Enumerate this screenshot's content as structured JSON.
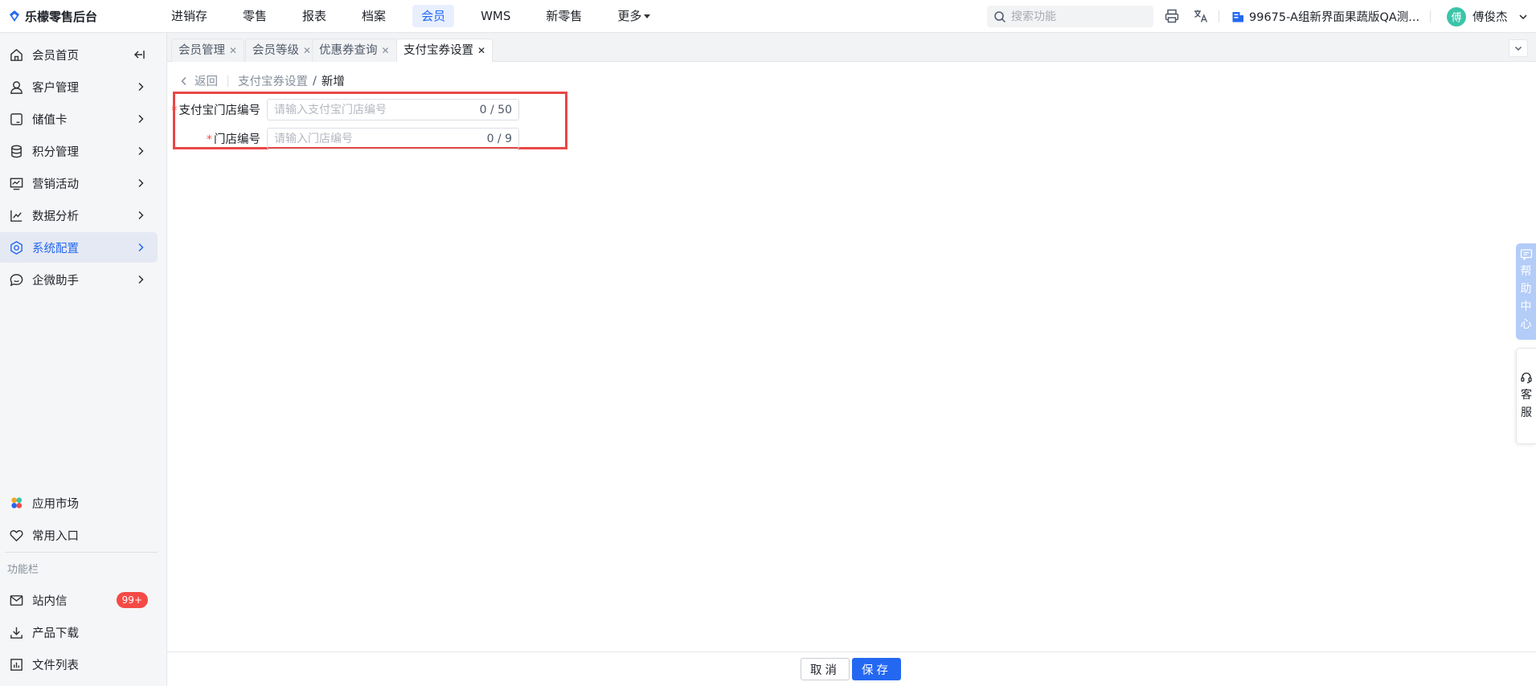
{
  "app": {
    "title": "乐檬零售后台"
  },
  "topnav": {
    "items": [
      "进销存",
      "零售",
      "报表",
      "档案",
      "会员",
      "WMS",
      "新零售",
      "更多"
    ],
    "active_index": 4,
    "search_placeholder": "搜索功能",
    "store_name": "99675-A组新界面果蔬版QA测...",
    "user_name": "傅俊杰",
    "avatar_char": "傅"
  },
  "sidebar": {
    "items": [
      {
        "label": "会员首页",
        "icon": "home-icon"
      },
      {
        "label": "客户管理",
        "icon": "user-icon"
      },
      {
        "label": "储值卡",
        "icon": "card-icon"
      },
      {
        "label": "积分管理",
        "icon": "database-icon"
      },
      {
        "label": "营销活动",
        "icon": "marketing-icon"
      },
      {
        "label": "数据分析",
        "icon": "chart-icon"
      },
      {
        "label": "系统配置",
        "icon": "settings-icon"
      },
      {
        "label": "企微助手",
        "icon": "chat-icon"
      }
    ],
    "active_index": 6,
    "bottom_items": [
      {
        "label": "应用市场",
        "icon": "app-market-icon"
      },
      {
        "label": "常用入口",
        "icon": "heart-icon"
      }
    ],
    "group_label": "功能栏",
    "function_items": [
      {
        "label": "站内信",
        "icon": "mail-icon",
        "badge": "99+"
      },
      {
        "label": "产品下载",
        "icon": "download-icon"
      },
      {
        "label": "文件列表",
        "icon": "file-list-icon"
      }
    ]
  },
  "tabs": [
    {
      "label": "会员管理",
      "active": false
    },
    {
      "label": "会员等级",
      "active": false
    },
    {
      "label": "优惠券查询",
      "active": false
    },
    {
      "label": "支付宝券设置",
      "active": true
    }
  ],
  "breadcrumb": {
    "back": "返回",
    "parent": "支付宝券设置",
    "separator": "/",
    "current": "新增"
  },
  "form": {
    "fields": [
      {
        "label": "支付宝门店编号",
        "placeholder": "请输入支付宝门店编号",
        "value": "",
        "count": "0 / 50",
        "required_mark": "*"
      },
      {
        "label": "门店编号",
        "placeholder": "请输入门店编号",
        "value": "",
        "count": "0 / 9",
        "required_mark": "*"
      }
    ]
  },
  "footer": {
    "cancel_label": "取消",
    "save_label": "保存"
  },
  "widgets": {
    "help_chars": [
      "帮",
      "助",
      "中",
      "心"
    ],
    "service_chars": [
      "客",
      "服"
    ]
  },
  "colors": {
    "primary": "#2468f2",
    "highlight": "#e94747",
    "badge": "#f54a45",
    "required": "#f54a45"
  }
}
